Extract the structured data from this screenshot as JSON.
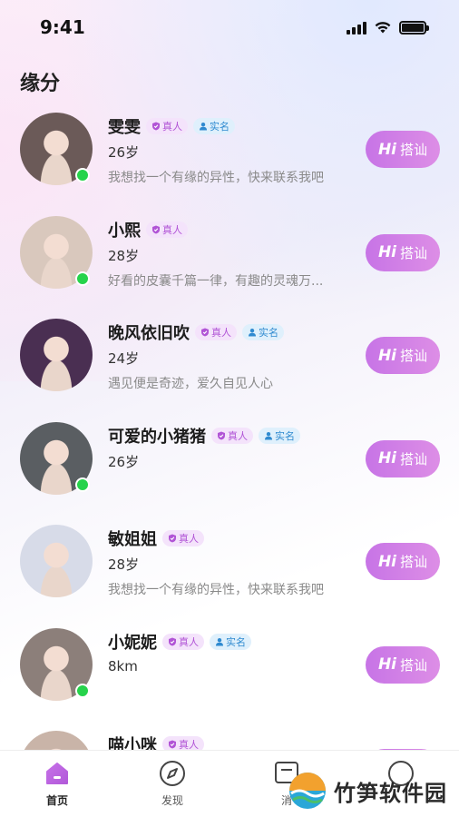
{
  "status_bar": {
    "time": "9:41"
  },
  "page_title": "缘分",
  "badges": {
    "real": "真人",
    "verified": "实名"
  },
  "button": {
    "hi": "Hi",
    "label": "搭讪"
  },
  "users": [
    {
      "name": "雯雯",
      "age": "26岁",
      "bio": "我想找一个有缘的异性，快来联系我吧",
      "real": true,
      "verified": true,
      "online": true,
      "avatar_color": "#6b5a58"
    },
    {
      "name": "小熙",
      "age": "28岁",
      "bio": "好看的皮囊千篇一律，有趣的灵魂万...",
      "real": true,
      "verified": false,
      "online": true,
      "avatar_color": "#d9c8bd"
    },
    {
      "name": "晚风依旧吹",
      "age": "24岁",
      "bio": "遇见便是奇迹，爱久自见人心",
      "real": true,
      "verified": true,
      "online": false,
      "avatar_color": "#4a2f52"
    },
    {
      "name": "可爱的小猪猪",
      "age": "26岁",
      "bio": "",
      "real": true,
      "verified": true,
      "online": true,
      "avatar_color": "#5a5e62"
    },
    {
      "name": "敏姐姐",
      "age": "28岁",
      "bio": "我想找一个有缘的异性，快来联系我吧",
      "real": true,
      "verified": false,
      "online": false,
      "avatar_color": "#d7dbe8"
    },
    {
      "name": "小妮妮",
      "age": "8km",
      "bio": "",
      "real": true,
      "verified": true,
      "online": true,
      "avatar_color": "#8c7f7a"
    },
    {
      "name": "喵小咪",
      "age": "",
      "bio": "",
      "real": true,
      "verified": false,
      "online": false,
      "avatar_color": "#c9b4a8"
    }
  ],
  "tabs": [
    {
      "label": "首页",
      "icon": "home-icon",
      "active": true
    },
    {
      "label": "发现",
      "icon": "compass-icon",
      "active": false
    },
    {
      "label": "消",
      "icon": "message-icon",
      "active": false
    },
    {
      "label": "",
      "icon": "profile-icon",
      "active": false
    }
  ],
  "watermark": "竹笋软件园",
  "colors": {
    "accent": "#c774e6",
    "online": "#26d34b",
    "real_badge": "#b154d6",
    "verified_badge": "#2f8ad0"
  }
}
